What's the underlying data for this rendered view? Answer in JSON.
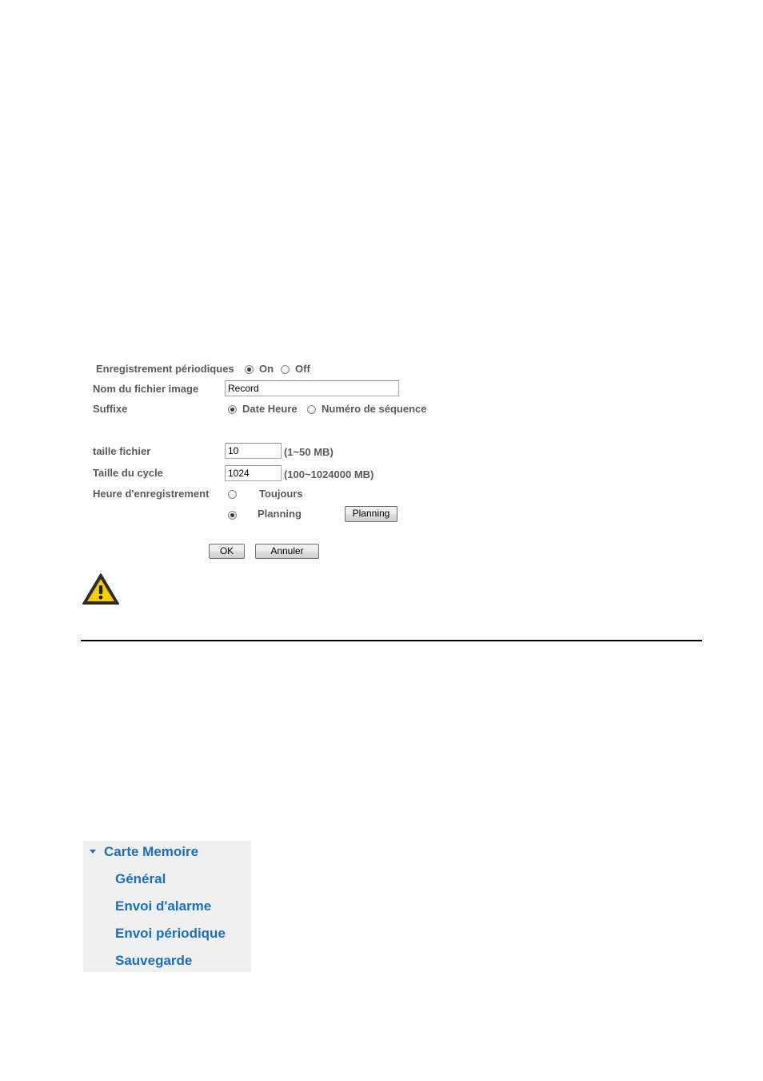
{
  "form": {
    "periodic_label": "Enregistrement périodiques",
    "periodic_on_label": "On",
    "periodic_off_label": "Off",
    "periodic_selected": "On",
    "filename_label": "Nom du fichier image",
    "filename_value": "Record",
    "suffix_label": "Suffixe",
    "suffix_option_date": "Date Heure",
    "suffix_option_seq": "Numéro de séquence",
    "suffix_selected": "Date Heure",
    "filesize_label": "taille fichier",
    "filesize_value": "10",
    "filesize_range": "(1~50 MB)",
    "cycle_label": "Taille du cycle",
    "cycle_value": "1024",
    "cycle_range": "(100~1024000 MB)",
    "rec_time_label": "Heure d'enregistrement",
    "rec_option_always": "Toujours",
    "rec_option_planning": "Planning",
    "rec_selected": "Planning",
    "planning_button": "Planning",
    "ok_button": "OK",
    "cancel_button": "Annuler"
  },
  "warning": {
    "icon": "warning-triangle-icon",
    "colors": {
      "fill": "#f5c400",
      "outline": "#2b2b2b"
    }
  },
  "nav": {
    "section_label": "Carte Memoire",
    "expanded": true,
    "items": [
      {
        "label": "Général"
      },
      {
        "label": "Envoi d'alarme"
      },
      {
        "label": "Envoi périodique"
      },
      {
        "label": "Sauvegarde"
      }
    ],
    "colors": {
      "link": "#1a6fc0",
      "background": "#f0f0f0"
    }
  }
}
